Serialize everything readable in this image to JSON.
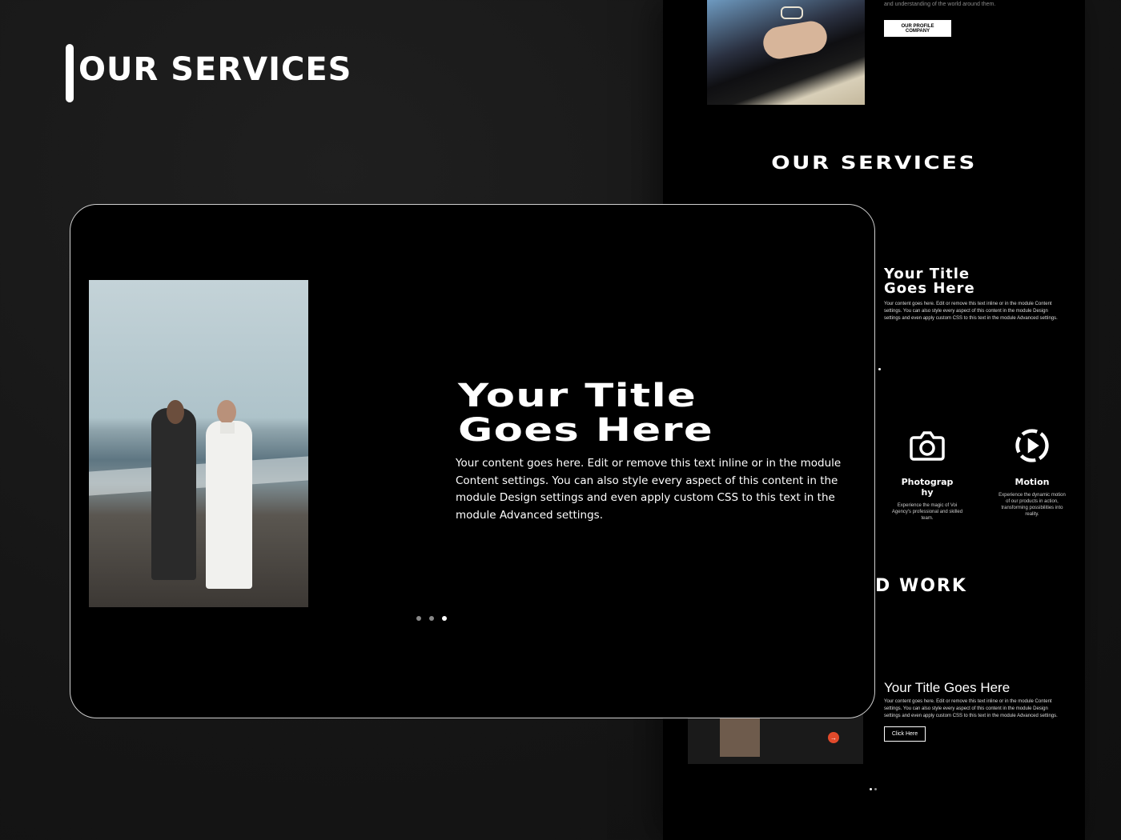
{
  "header": {
    "title": "OUR SERVICES"
  },
  "site": {
    "tagline": "and understanding of the world around them.",
    "profile_button": "OUR PROFILE COMPANY",
    "services_title": "OUR SERVICES",
    "card_title_line1": "Your Title",
    "card_title_line2": "Goes Here",
    "card_desc": "Your content goes here. Edit or remove this text inline or in the module Content settings. You can also style every aspect of this content in the module Design settings and even apply custom CSS to this text in the module Advanced settings.",
    "services": [
      {
        "icon": "camera-icon",
        "name_line1": "Photograp",
        "name_line2": "hy",
        "desc": "Experience the magic of Voi Agency's professional and skilled team."
      },
      {
        "icon": "play-icon",
        "name_line1": "Motion",
        "name_line2": "",
        "desc": "Experience the dynamic motion of our products in action, transforming possibilities into reality."
      }
    ],
    "work_title": "ED WORK",
    "work_item_title": "Your Title Goes Here",
    "work_item_desc": "Your content goes here. Edit or remove this text inline or in the module Content settings. You can also style every aspect of this content in the module Design settings and even apply custom CSS to this text in the module Advanced settings.",
    "click_button": "Click Here"
  },
  "card": {
    "title_line1": "Your Title",
    "title_line2": "Goes Here",
    "desc": "Your content goes here. Edit or remove this text inline or in the module Content settings. You can also style every aspect of this content in the module Design settings and even apply custom CSS to this text in the module Advanced settings.",
    "slide_count": 3,
    "active_slide": 3
  },
  "colors": {
    "background": "#151515",
    "card": "#000000",
    "accent": "#e14a2b"
  }
}
